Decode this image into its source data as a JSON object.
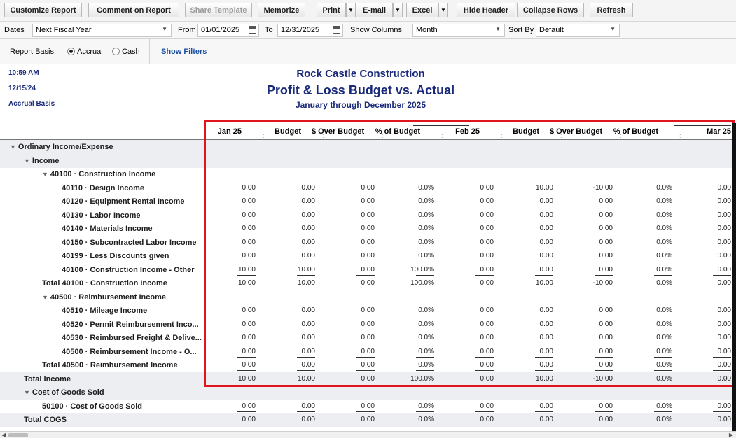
{
  "toolbar": {
    "customize": "Customize Report",
    "comment": "Comment on Report",
    "share": "Share Template",
    "memorize": "Memorize",
    "print": "Print",
    "email": "E-mail",
    "excel": "Excel",
    "hide_header": "Hide Header",
    "collapse_rows": "Collapse Rows",
    "refresh": "Refresh"
  },
  "filters": {
    "dates_label": "Dates",
    "dates_value": "Next Fiscal Year",
    "from_label": "From",
    "from_value": "01/01/2025",
    "to_label": "To",
    "to_value": "12/31/2025",
    "show_columns_label": "Show Columns",
    "show_columns_value": "Month",
    "sort_by_label": "Sort By",
    "sort_by_value": "Default"
  },
  "basis": {
    "label": "Report Basis:",
    "accrual": "Accrual",
    "cash": "Cash",
    "selected": "Accrual",
    "show_filters": "Show Filters"
  },
  "report": {
    "time": "10:59 AM",
    "date": "12/15/24",
    "basis": "Accrual Basis",
    "company": "Rock Castle Construction",
    "title": "Profit & Loss Budget vs. Actual",
    "period": "January through December 2025"
  },
  "columns": [
    "Jan 25",
    "Budget",
    "$ Over Budget",
    "% of Budget",
    "Feb 25",
    "Budget",
    "$ Over Budget",
    "% of Budget",
    "Mar 25"
  ],
  "rows": [
    {
      "label": "Ordinary Income/Expense",
      "indent": 0,
      "toggle": true,
      "shaded": true,
      "values": []
    },
    {
      "label": "Income",
      "indent": 1,
      "toggle": true,
      "shaded": true,
      "values": []
    },
    {
      "label": "40100 · Construction Income",
      "indent": 2,
      "toggle": true,
      "shaded": false,
      "values": []
    },
    {
      "label": "40110 · Design Income",
      "indent": 3,
      "values": [
        "0.00",
        "0.00",
        "0.00",
        "0.0%",
        "0.00",
        "10.00",
        "-10.00",
        "0.0%",
        "0.00"
      ]
    },
    {
      "label": "40120 · Equipment Rental Income",
      "indent": 3,
      "values": [
        "0.00",
        "0.00",
        "0.00",
        "0.0%",
        "0.00",
        "0.00",
        "0.00",
        "0.0%",
        "0.00"
      ]
    },
    {
      "label": "40130 · Labor Income",
      "indent": 3,
      "values": [
        "0.00",
        "0.00",
        "0.00",
        "0.0%",
        "0.00",
        "0.00",
        "0.00",
        "0.0%",
        "0.00"
      ]
    },
    {
      "label": "40140 · Materials Income",
      "indent": 3,
      "values": [
        "0.00",
        "0.00",
        "0.00",
        "0.0%",
        "0.00",
        "0.00",
        "0.00",
        "0.0%",
        "0.00"
      ]
    },
    {
      "label": "40150 · Subcontracted Labor Income",
      "indent": 3,
      "values": [
        "0.00",
        "0.00",
        "0.00",
        "0.0%",
        "0.00",
        "0.00",
        "0.00",
        "0.0%",
        "0.00"
      ]
    },
    {
      "label": "40199 · Less Discounts given",
      "indent": 3,
      "values": [
        "0.00",
        "0.00",
        "0.00",
        "0.0%",
        "0.00",
        "0.00",
        "0.00",
        "0.0%",
        "0.00"
      ]
    },
    {
      "label": "40100 · Construction Income - Other",
      "indent": 3,
      "underline": true,
      "values": [
        "10.00",
        "10.00",
        "0.00",
        "100.0%",
        "0.00",
        "0.00",
        "0.00",
        "0.0%",
        "0.00"
      ]
    },
    {
      "label": "Total 40100 · Construction Income",
      "indent": 2,
      "values": [
        "10.00",
        "10.00",
        "0.00",
        "100.0%",
        "0.00",
        "10.00",
        "-10.00",
        "0.0%",
        "0.00"
      ]
    },
    {
      "label": "40500 · Reimbursement Income",
      "indent": 2,
      "toggle": true,
      "values": []
    },
    {
      "label": "40510 · Mileage Income",
      "indent": 3,
      "values": [
        "0.00",
        "0.00",
        "0.00",
        "0.0%",
        "0.00",
        "0.00",
        "0.00",
        "0.0%",
        "0.00"
      ]
    },
    {
      "label": "40520 · Permit Reimbursement Inco...",
      "indent": 3,
      "values": [
        "0.00",
        "0.00",
        "0.00",
        "0.0%",
        "0.00",
        "0.00",
        "0.00",
        "0.0%",
        "0.00"
      ]
    },
    {
      "label": "40530 · Reimbursed Freight & Delive...",
      "indent": 3,
      "values": [
        "0.00",
        "0.00",
        "0.00",
        "0.0%",
        "0.00",
        "0.00",
        "0.00",
        "0.0%",
        "0.00"
      ]
    },
    {
      "label": "40500 · Reimbursement Income - O...",
      "indent": 3,
      "underline": true,
      "values": [
        "0.00",
        "0.00",
        "0.00",
        "0.0%",
        "0.00",
        "0.00",
        "0.00",
        "0.0%",
        "0.00"
      ]
    },
    {
      "label": "Total 40500 · Reimbursement Income",
      "indent": 2,
      "underline": true,
      "values": [
        "0.00",
        "0.00",
        "0.00",
        "0.0%",
        "0.00",
        "0.00",
        "0.00",
        "0.0%",
        "0.00"
      ]
    },
    {
      "label": "Total Income",
      "indent": 1,
      "shaded": true,
      "values": [
        "10.00",
        "10.00",
        "0.00",
        "100.0%",
        "0.00",
        "10.00",
        "-10.00",
        "0.0%",
        "0.00"
      ]
    },
    {
      "label": "Cost of Goods Sold",
      "indent": 1,
      "toggle": true,
      "shaded": true,
      "values": []
    },
    {
      "label": "50100 · Cost of Goods Sold",
      "indent": 2,
      "underline": true,
      "values": [
        "0.00",
        "0.00",
        "0.00",
        "0.0%",
        "0.00",
        "0.00",
        "0.00",
        "0.0%",
        "0.00"
      ]
    },
    {
      "label": "Total COGS",
      "indent": 1,
      "shaded": true,
      "underline": true,
      "values": [
        "0.00",
        "0.00",
        "0.00",
        "0.0%",
        "0.00",
        "0.00",
        "0.00",
        "0.0%",
        "0.00"
      ]
    }
  ],
  "colors": {
    "title": "#1a2a7a",
    "highlight_box": "#e0141c",
    "link": "#1a4fa0"
  }
}
